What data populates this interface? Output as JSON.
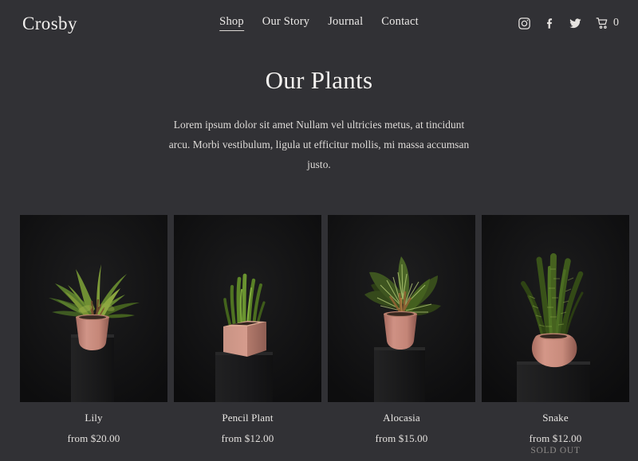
{
  "header": {
    "logo": "Crosby",
    "nav": [
      {
        "label": "Shop",
        "active": true
      },
      {
        "label": "Our Story",
        "active": false
      },
      {
        "label": "Journal",
        "active": false
      },
      {
        "label": "Contact",
        "active": false
      }
    ],
    "social": [
      {
        "name": "instagram-icon"
      },
      {
        "name": "facebook-icon"
      },
      {
        "name": "twitter-icon"
      }
    ],
    "cart": {
      "icon": "shopping-cart-icon",
      "count": "0"
    }
  },
  "intro": {
    "title": "Our Plants",
    "body": "Lorem ipsum dolor sit amet Nullam vel ultricies metus, at tincidunt arcu. Morbi vestibulum, ligula ut efficitur mollis, mi massa accumsan justo."
  },
  "products": [
    {
      "name": "Lily",
      "price": "from $20.00",
      "sold_out": "",
      "image_alt": "lily-plant-photo"
    },
    {
      "name": "Pencil Plant",
      "price": "from $12.00",
      "sold_out": "",
      "image_alt": "pencil-plant-photo"
    },
    {
      "name": "Alocasia",
      "price": "from $15.00",
      "sold_out": "",
      "image_alt": "alocasia-plant-photo"
    },
    {
      "name": "Snake",
      "price": "from $12.00",
      "sold_out": "SOLD OUT",
      "image_alt": "snake-plant-photo"
    }
  ],
  "colors": {
    "background": "#313135",
    "card_background": "#141415",
    "text": "#e8e6e4",
    "muted_text": "#8d8a88",
    "pot_pink": "#cf9285",
    "pot_pink_shadow": "#a86d62",
    "foliage_green": "#4d6a2a",
    "foliage_green_dark": "#24330f",
    "pedestal": "#1b1b1c"
  }
}
